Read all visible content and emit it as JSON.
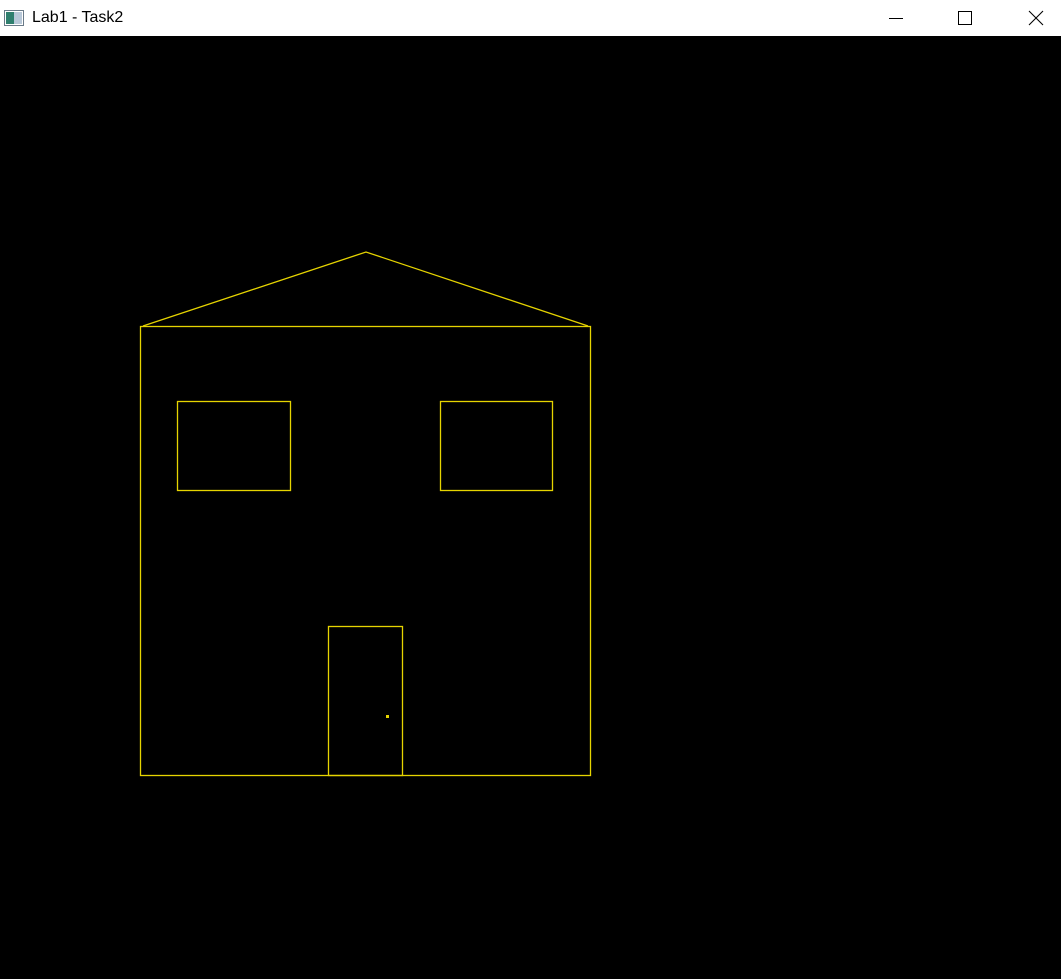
{
  "window": {
    "title": "Lab1 - Task2",
    "icon": "app-window-icon",
    "controls": {
      "minimize_icon": "minimize-icon",
      "maximize_icon": "maximize-icon",
      "close_icon": "close-icon"
    }
  },
  "scene": {
    "background_color": "#000000",
    "line_color": "#e6d400",
    "objects": [
      "roof",
      "house-wall",
      "left-window",
      "right-window",
      "door",
      "door-knob"
    ]
  }
}
